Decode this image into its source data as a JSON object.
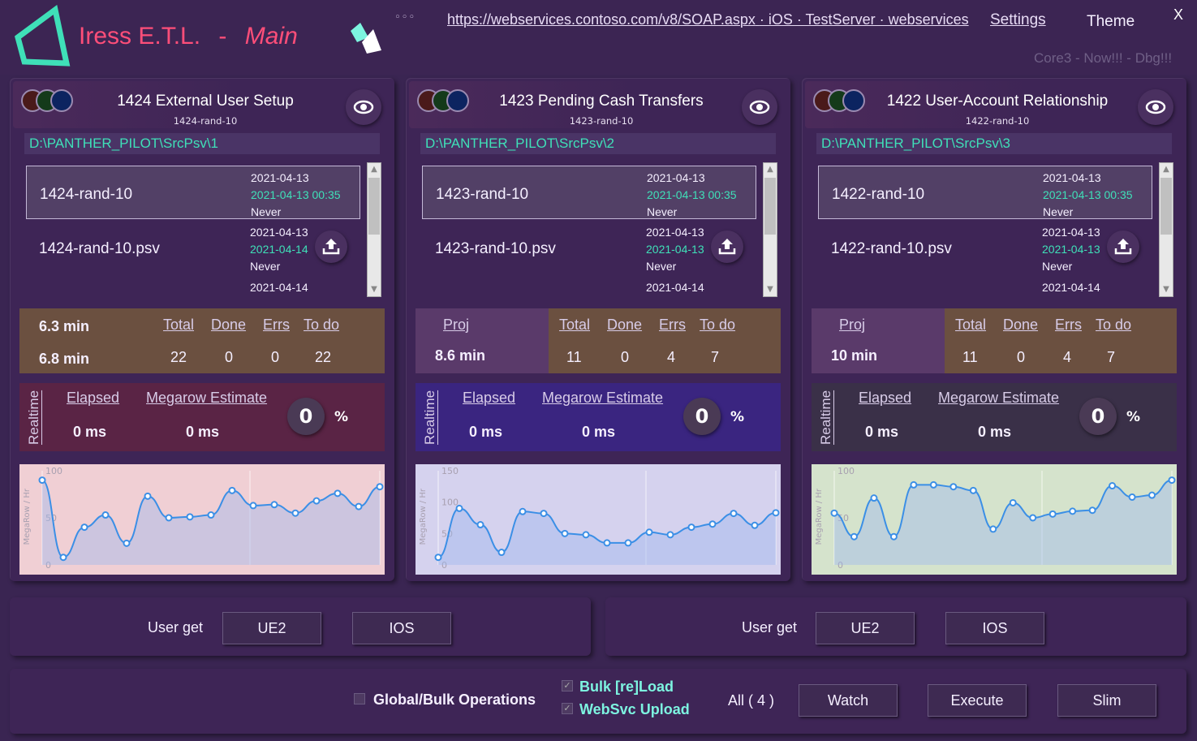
{
  "app": {
    "title": "Iress E.T.L.",
    "separator": "-",
    "subtitle": "Main",
    "menu_dots": "◦◦◦",
    "connection_url": "https://webservices.contoso.com/v8/SOAP.aspx",
    "connection_rest": "· iOS · TestServer · webservices",
    "settings_label": "Settings",
    "theme_label": "Theme",
    "close_label": "X",
    "core_version": "Core3 - Now!!! - Dbg!!!"
  },
  "panels": [
    {
      "title": "1424 External User Setup",
      "subtitle": "1424-rand-10",
      "path": "D:\\PANTHER_PILOT\\SrcPsv\\1",
      "items": [
        {
          "name": "1424-rand-10",
          "date1": "2021-04-13",
          "date2": "2021-04-13 00:35",
          "date3": "Never"
        },
        {
          "name": "1424-rand-10.psv",
          "date1": "2021-04-13",
          "date2": "2021-04-14",
          "date3": "Never"
        },
        {
          "name": "",
          "date1": "2021-04-14",
          "date2": "",
          "date3": ""
        }
      ],
      "left_h": "6.3 min",
      "left_v": "6.8 min",
      "headers": {
        "total": "Total",
        "done": "Done",
        "errs": "Errs",
        "todo": "To do"
      },
      "values": {
        "total": "22",
        "done": "0",
        "errs": "0",
        "todo": "22"
      },
      "realtime_label": "Realtime",
      "elapsed_label": "Elapsed",
      "elapsed_value": "0 ms",
      "megarow_label": "Megarow Estimate",
      "megarow_value": "0 ms",
      "percent_value": "0",
      "percent_sign": "%",
      "chart_data": {
        "type": "line",
        "ylabel": "MegaRow / Hr",
        "yticks": [
          "100",
          "50",
          "0"
        ],
        "ylim": [
          0,
          100
        ],
        "values": [
          90,
          8,
          40,
          53,
          23,
          73,
          50,
          51,
          53,
          79,
          63,
          64,
          55,
          68,
          76,
          62,
          83
        ]
      }
    },
    {
      "title": "1423 Pending Cash Transfers",
      "subtitle": "1423-rand-10",
      "path": "D:\\PANTHER_PILOT\\SrcPsv\\2",
      "items": [
        {
          "name": "1423-rand-10",
          "date1": "2021-04-13",
          "date2": "2021-04-13 00:35",
          "date3": "Never"
        },
        {
          "name": "1423-rand-10.psv",
          "date1": "2021-04-13",
          "date2": "2021-04-13",
          "date3": "Never"
        },
        {
          "name": "",
          "date1": "2021-04-14",
          "date2": "",
          "date3": ""
        }
      ],
      "left_h": "Proj",
      "left_v": "8.6 min",
      "headers": {
        "total": "Total",
        "done": "Done",
        "errs": "Errs",
        "todo": "To do"
      },
      "values": {
        "total": "11",
        "done": "0",
        "errs": "4",
        "todo": "7"
      },
      "realtime_label": "Realtime",
      "elapsed_label": "Elapsed",
      "elapsed_value": "0 ms",
      "megarow_label": "Megarow Estimate",
      "megarow_value": "0 ms",
      "percent_value": "0",
      "percent_sign": "%",
      "chart_data": {
        "type": "line",
        "ylabel": "MegaRow / Hr",
        "yticks": [
          "150",
          "100",
          "50",
          "0"
        ],
        "ylim": [
          0,
          150
        ],
        "values": [
          12,
          90,
          64,
          20,
          85,
          82,
          50,
          48,
          35,
          35,
          52,
          48,
          60,
          65,
          82,
          63,
          83
        ]
      }
    },
    {
      "title": "1422 User-Account Relationship",
      "subtitle": "1422-rand-10",
      "path": "D:\\PANTHER_PILOT\\SrcPsv\\3",
      "items": [
        {
          "name": "1422-rand-10",
          "date1": "2021-04-13",
          "date2": "2021-04-13 00:35",
          "date3": "Never"
        },
        {
          "name": "1422-rand-10.psv",
          "date1": "2021-04-13",
          "date2": "2021-04-13",
          "date3": "Never"
        },
        {
          "name": "",
          "date1": "2021-04-14",
          "date2": "",
          "date3": ""
        }
      ],
      "left_h": "Proj",
      "left_v": "10 min",
      "headers": {
        "total": "Total",
        "done": "Done",
        "errs": "Errs",
        "todo": "To do"
      },
      "values": {
        "total": "11",
        "done": "0",
        "errs": "4",
        "todo": "7"
      },
      "realtime_label": "Realtime",
      "elapsed_label": "Elapsed",
      "elapsed_value": "0 ms",
      "megarow_label": "Megarow Estimate",
      "megarow_value": "0 ms",
      "percent_value": "0",
      "percent_sign": "%",
      "chart_data": {
        "type": "line",
        "ylabel": "MegaRow / Hr",
        "yticks": [
          "100",
          "50",
          "0"
        ],
        "ylim": [
          0,
          100
        ],
        "values": [
          55,
          30,
          71,
          30,
          85,
          85,
          83,
          79,
          38,
          66,
          50,
          54,
          57,
          58,
          84,
          72,
          74,
          90
        ]
      }
    }
  ],
  "user_get": [
    {
      "label": "User get",
      "btn1": "UE2",
      "btn2": "IOS"
    },
    {
      "label": "User get",
      "btn1": "UE2",
      "btn2": "IOS"
    }
  ],
  "global": {
    "label": "Global/Bulk Operations",
    "bulk_reload": "Bulk [re]Load",
    "websvc_upload": "WebSvc Upload",
    "count": "All ( 4 )",
    "watch": "Watch",
    "execute": "Execute",
    "slim": "Slim"
  },
  "colors": {
    "accent_pink": "#ff4e79",
    "accent_teal": "#3fe0b8",
    "chart1_bg": "#f0cfd4",
    "chart2_bg": "#d5d2ee",
    "chart3_bg": "#d5e3cc",
    "line": "#3b8fe6"
  }
}
